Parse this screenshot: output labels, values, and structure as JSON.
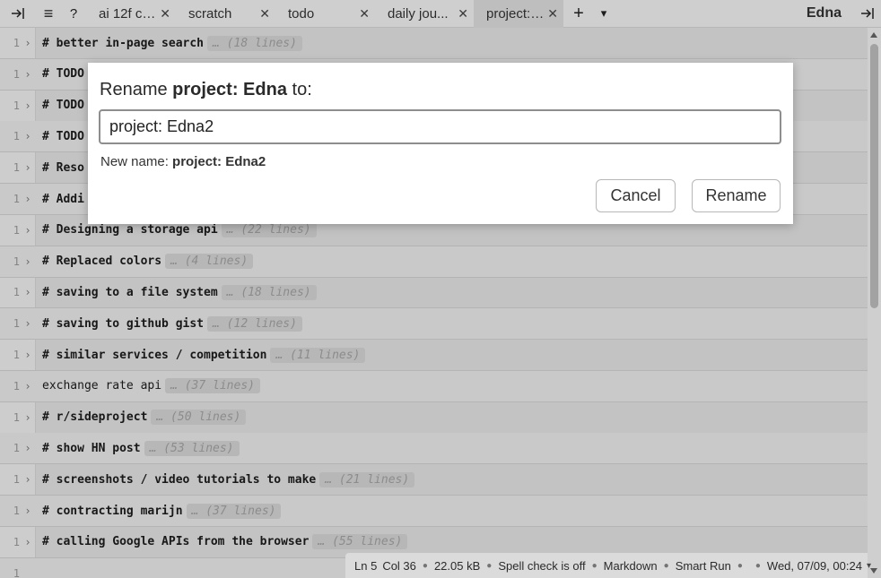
{
  "tabbar": {
    "left_icon": "collapse-right-icon",
    "menu_glyph": "≡",
    "help_label": "?",
    "tabs": [
      {
        "title": "ai 12f ch...",
        "close": "✕",
        "active": false
      },
      {
        "title": "scratch",
        "close": "✕",
        "active": false
      },
      {
        "title": "todo",
        "close": "✕",
        "active": false
      },
      {
        "title": "daily jou...",
        "close": "✕",
        "active": false
      },
      {
        "title": "project: ...",
        "close": "✕",
        "active": true
      }
    ],
    "add_label": "+",
    "dropdown_glyph": "▾",
    "app_title": "Edna",
    "right_icon": "collapse-right-icon"
  },
  "editor": {
    "rows": [
      {
        "ln": "1",
        "fold": "›",
        "text": "# better in-page search",
        "folded": "… (18 lines)",
        "bold": true
      },
      {
        "ln": "1",
        "fold": "›",
        "text": "# TODO",
        "folded": "",
        "bold": true
      },
      {
        "ln": "1",
        "fold": "›",
        "text": "# TODO",
        "folded": "",
        "bold": true
      },
      {
        "ln": "1",
        "fold": "›",
        "text": "# TODO",
        "folded": "",
        "bold": true
      },
      {
        "ln": "1",
        "fold": "›",
        "text": "# Reso",
        "folded": "",
        "bold": true
      },
      {
        "ln": "1",
        "fold": "›",
        "text": "# Addi",
        "folded": "",
        "bold": true
      },
      {
        "ln": "1",
        "fold": "›",
        "text": "# Designing a storage api",
        "folded": "… (22 lines)",
        "bold": true
      },
      {
        "ln": "1",
        "fold": "›",
        "text": "# Replaced colors",
        "folded": "… (4 lines)",
        "bold": true
      },
      {
        "ln": "1",
        "fold": "›",
        "text": "# saving to a file system",
        "folded": "… (18 lines)",
        "bold": true
      },
      {
        "ln": "1",
        "fold": "›",
        "text": "# saving to github gist",
        "folded": "… (12 lines)",
        "bold": true
      },
      {
        "ln": "1",
        "fold": "›",
        "text": "# similar services / competition",
        "folded": "… (11 lines)",
        "bold": true
      },
      {
        "ln": "1",
        "fold": "›",
        "text": "exchange rate api",
        "folded": "… (37 lines)",
        "bold": false
      },
      {
        "ln": "1",
        "fold": "›",
        "text": "# r/sideproject",
        "folded": "… (50 lines)",
        "bold": true
      },
      {
        "ln": "1",
        "fold": "›",
        "text": "# show HN post",
        "folded": "… (53 lines)",
        "bold": true
      },
      {
        "ln": "1",
        "fold": "›",
        "text": "# screenshots / video tutorials to make",
        "folded": "… (21 lines)",
        "bold": true
      },
      {
        "ln": "1",
        "fold": "›",
        "text": "# contracting marijn",
        "folded": "… (37 lines)",
        "bold": true
      },
      {
        "ln": "1",
        "fold": "›",
        "text": "# calling Google APIs from the browser",
        "folded": "… (55 lines)",
        "bold": true
      },
      {
        "ln": "1",
        "fold": "",
        "text": "",
        "folded": "",
        "bold": false
      }
    ]
  },
  "statusbar": {
    "ln": "Ln 5",
    "col": "Col 36",
    "size": "22.05 kB",
    "spell": "Spell check is off",
    "language": "Markdown",
    "smart_run": "Smart Run",
    "icon": "stop-icon",
    "datetime": "Wed, 07/09, 00:24",
    "chevron": "▾"
  },
  "dialog": {
    "title_prefix": "Rename ",
    "title_name": "project: Edna",
    "title_suffix": " to:",
    "input_value": "project: Edna2",
    "new_name_label": "New name: ",
    "new_name_value": "project: Edna2",
    "cancel_label": "Cancel",
    "rename_label": "Rename"
  },
  "colors": {
    "active_tab": "#dedede",
    "editor_bg": "#e3e3e3",
    "folded_text": "#a3a3a3"
  }
}
